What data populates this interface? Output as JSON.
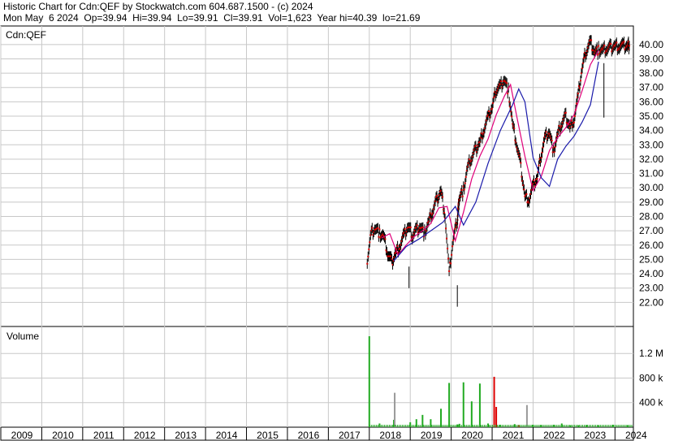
{
  "header": {
    "line1": "Historic Chart for Cdn:QEF by Stockwatch.com 604.687.1500 - (c) 2024",
    "line2": "Mon May  6 2024  Op=39.94  Hi=39.94  Lo=39.91  Cl=39.91  Vol=1,623  Year hi=40.39  lo=21.69"
  },
  "colors": {
    "price_bar": "#000000",
    "close_dot": "#dd0000",
    "ma_short": "#e0007a",
    "ma_long": "#1a1aaa",
    "grid": "#c8c8c8",
    "vol_up": "#22aa22",
    "vol_down": "#dd0000",
    "vol_neutral": "#999999"
  },
  "chart_data": [
    {
      "type": "line",
      "title": "Cdn:QEF",
      "ylim": [
        21,
        40.5
      ],
      "y_ticks": [
        "22.00",
        "23.00",
        "24.00",
        "25.00",
        "26.00",
        "27.00",
        "28.00",
        "29.00",
        "30.00",
        "31.00",
        "32.00",
        "33.00",
        "34.00",
        "35.00",
        "36.00",
        "37.00",
        "38.00",
        "39.00",
        "40.00"
      ],
      "x_ticks": [
        "2009",
        "2010",
        "2011",
        "2012",
        "2013",
        "2014",
        "2015",
        "2016",
        "2017",
        "2018",
        "2019",
        "2020",
        "2021",
        "2022",
        "2023",
        "2024"
      ],
      "x_range": [
        2009.0,
        2024.45
      ],
      "grid": true,
      "series": [
        {
          "x": [
            2017.95,
            2018.05,
            2018.15,
            2018.25,
            2018.35,
            2018.45,
            2018.55,
            2018.65,
            2018.75,
            2018.85,
            2018.95,
            2019.05,
            2019.15,
            2019.25,
            2019.35,
            2019.45,
            2019.55,
            2019.65,
            2019.75,
            2019.85,
            2019.95,
            2020.05,
            2020.15,
            2020.17,
            2020.2,
            2020.3,
            2020.4,
            2020.5,
            2020.6,
            2020.7,
            2020.8,
            2020.9,
            2021.0,
            2021.1,
            2021.2,
            2021.3,
            2021.4,
            2021.5,
            2021.6,
            2021.7,
            2021.8,
            2021.9,
            2022.0,
            2022.1,
            2022.2,
            2022.3,
            2022.4,
            2022.5,
            2022.6,
            2022.7,
            2022.8,
            2022.9,
            2023.0,
            2023.1,
            2023.2,
            2023.3,
            2023.4,
            2023.5,
            2023.6,
            2023.7,
            2023.8,
            2023.9,
            2024.0,
            2024.1,
            2024.2,
            2024.3,
            2024.35
          ],
          "y": [
            25.0,
            26.9,
            27.2,
            26.8,
            26.6,
            25.4,
            24.8,
            25.5,
            26.0,
            26.7,
            27.3,
            26.7,
            27.1,
            27.3,
            26.8,
            27.6,
            28.4,
            29.2,
            29.8,
            28.1,
            24.0,
            26.4,
            27.8,
            28.5,
            29.3,
            29.8,
            31.4,
            32.1,
            32.7,
            33.2,
            34.1,
            34.9,
            35.6,
            36.9,
            37.1,
            37.6,
            36.7,
            34.4,
            33.0,
            31.5,
            29.4,
            29.2,
            30.1,
            30.7,
            32.4,
            33.6,
            33.9,
            32.5,
            33.7,
            34.5,
            35.0,
            34.2,
            34.8,
            36.4,
            38.4,
            39.6,
            40.2,
            39.5,
            39.6,
            39.6,
            39.7,
            39.8,
            39.9,
            39.9,
            39.9,
            39.9,
            39.91
          ]
        },
        {
          "name": "",
          "x": [
            2018.3,
            2018.5,
            2018.7,
            2018.9,
            2019.1,
            2019.3,
            2019.5,
            2019.7,
            2019.9,
            2020.1,
            2020.3,
            2020.5,
            2020.7,
            2020.9,
            2021.1,
            2021.3,
            2021.45,
            2021.6,
            2021.8,
            2022.0,
            2022.2,
            2022.4,
            2022.6,
            2022.8,
            2023.0,
            2023.2,
            2023.4,
            2023.6
          ],
          "y": [
            26.5,
            26.8,
            25.3,
            26.0,
            26.6,
            27.0,
            27.5,
            28.6,
            28.7,
            26.3,
            28.3,
            30.6,
            32.2,
            33.4,
            35.1,
            36.4,
            37.2,
            35.0,
            32.2,
            29.8,
            30.8,
            32.6,
            33.5,
            34.2,
            35.1,
            36.8,
            38.6,
            39.6
          ]
        },
        {
          "name": "",
          "x": [
            2018.6,
            2018.9,
            2019.2,
            2019.5,
            2019.8,
            2020.1,
            2020.3,
            2020.6,
            2020.9,
            2021.2,
            2021.5,
            2021.65,
            2021.8,
            2022.0,
            2022.2,
            2022.4,
            2022.6,
            2022.8,
            2023.0,
            2023.2,
            2023.4,
            2023.6
          ],
          "y": [
            24.9,
            25.9,
            26.4,
            27.0,
            27.6,
            28.7,
            27.4,
            29.0,
            31.7,
            34.0,
            35.8,
            36.9,
            36.0,
            32.1,
            30.7,
            30.1,
            32.0,
            32.9,
            33.6,
            34.6,
            35.8,
            38.8
          ]
        }
      ]
    },
    {
      "type": "bar",
      "title": "Volume",
      "y_ticks": [
        "400 k",
        "800 k",
        "1.2 M"
      ],
      "ylim": [
        0,
        1480000
      ],
      "x": [
        2018.0,
        2018.25,
        2018.6,
        2018.62,
        2019.0,
        2019.15,
        2019.3,
        2019.5,
        2019.75,
        2019.95,
        2020.15,
        2020.2,
        2020.3,
        2020.5,
        2020.7,
        2020.9,
        2021.05,
        2021.1,
        2021.2,
        2021.55,
        2021.65,
        2021.85,
        2022.0,
        2022.2,
        2022.5,
        2022.7,
        2022.9,
        2023.1,
        2023.3,
        2023.6,
        2023.95,
        2024.3
      ],
      "values": [
        1480000,
        60000,
        120000,
        560000,
        80000,
        130000,
        200000,
        130000,
        300000,
        720000,
        45000,
        55000,
        730000,
        420000,
        710000,
        60000,
        820000,
        330000,
        40000,
        50000,
        35000,
        360000,
        40000,
        35000,
        40000,
        60000,
        30000,
        30000,
        35000,
        30000,
        40000,
        30000
      ],
      "colors": [
        "vol_up",
        "vol_up",
        "vol_up",
        "vol_neutral",
        "vol_up",
        "vol_up",
        "vol_up",
        "vol_up",
        "vol_up",
        "vol_up",
        "vol_up",
        "vol_up",
        "vol_up",
        "vol_up",
        "vol_up",
        "vol_up",
        "vol_down",
        "vol_down",
        "vol_up",
        "vol_up",
        "vol_down",
        "vol_neutral",
        "vol_up",
        "vol_up",
        "vol_up",
        "vol_up",
        "vol_up",
        "vol_up",
        "vol_up",
        "vol_up",
        "vol_up",
        "vol_up"
      ]
    }
  ]
}
